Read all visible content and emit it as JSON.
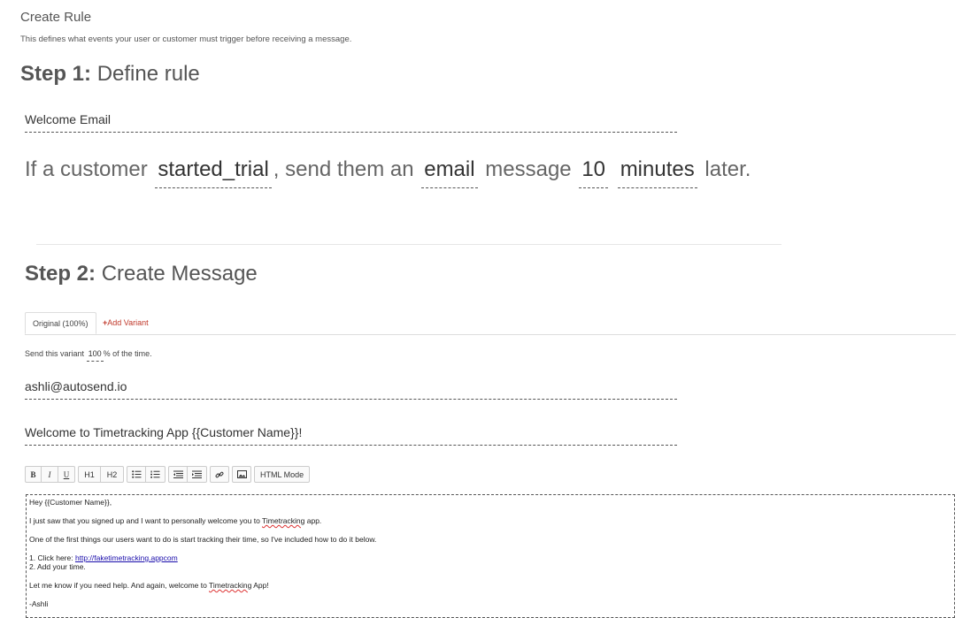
{
  "header": {
    "title": "Create Rule",
    "description": "This defines what events your user or customer must trigger before receiving a message."
  },
  "step1": {
    "label": "Step 1:",
    "title": "Define rule",
    "rule_name": "Welcome Email",
    "sentence": {
      "prefix": "If a customer",
      "event": "started_trial",
      "mid1": ", send them an",
      "channel": "email",
      "mid2": "message",
      "delay_amount": "10",
      "delay_unit": "minutes",
      "suffix": "later."
    }
  },
  "step2": {
    "label": "Step 2:",
    "title": "Create Message",
    "tabs": [
      {
        "label": "Original (100%)"
      },
      {
        "label": "Add Variant"
      }
    ],
    "send_prefix": "Send this variant",
    "send_percent": "100",
    "send_suffix": "% of the time.",
    "from": "ashli@autosend.io",
    "subject": "Welcome to Timetracking App {{Customer Name}}!",
    "toolbar": {
      "bold": "B",
      "italic": "I",
      "underline": "U",
      "h1": "H1",
      "h2": "H2",
      "html_mode": "HTML Mode"
    },
    "body": {
      "greeting": "Hey {{Customer Name}},",
      "line1_a": "I just saw that you signed up and I want to personally welcome you to ",
      "line1_word": "Timetracking",
      "line1_b": " app.",
      "line2": "One of the first things our users want to do is start tracking their time, so I've included how to do it below.",
      "step1_prefix": "1. Click here: ",
      "step1_link": "http://faketimetracking.appcom",
      "step2": "2. Add your time.",
      "line3_a": "Let me know if you need help. And again, welcome to ",
      "line3_word": "Timetracking",
      "line3_b": " App!",
      "signature": "-Ashli"
    }
  }
}
